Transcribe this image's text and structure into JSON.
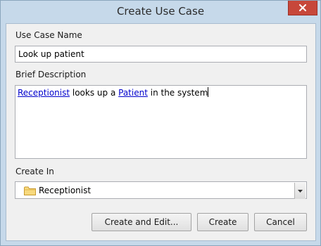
{
  "window": {
    "title": "Create Use Case"
  },
  "form": {
    "name_label": "Use Case Name",
    "name_value": "Look up patient",
    "description_label": "Brief Description",
    "description": {
      "link1": "Receptionist",
      "text1": " looks up a ",
      "link2": "Patient",
      "text2": " in the system"
    },
    "create_in_label": "Create In",
    "create_in_value": "Receptionist"
  },
  "buttons": {
    "create_and_edit": "Create and Edit...",
    "create": "Create",
    "cancel": "Cancel"
  },
  "colors": {
    "link": "#0000cc",
    "close_button": "#c7473a",
    "frame": "#c6d9ea"
  },
  "icons": {
    "close": "close-icon",
    "folder": "folder-icon",
    "dropdown": "chevron-down-icon"
  }
}
